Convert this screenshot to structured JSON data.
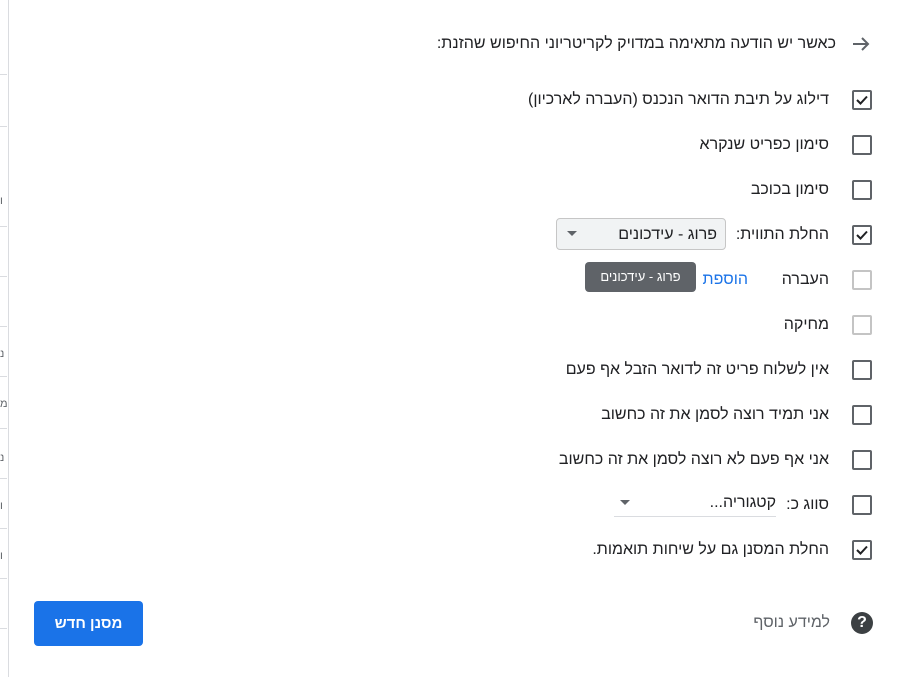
{
  "header": {
    "text": "כאשר יש הודעה מתאימה במדויק לקריטריוני החיפוש שהזנת:",
    "back_icon": "arrow-right-icon"
  },
  "left_edge_glyphs": [
    "ו",
    "נ",
    "מ",
    "נ",
    "ו",
    "ו"
  ],
  "options": [
    {
      "label": "דילוג על תיבת הדואר הנכנס (העברה לארכיון)",
      "checked": true,
      "enabled": true
    },
    {
      "label": "סימון כפריט שנקרא",
      "checked": false,
      "enabled": true
    },
    {
      "label": "סימון בכוכב",
      "checked": false,
      "enabled": true
    },
    {
      "label": "החלת התווית:",
      "checked": true,
      "enabled": true,
      "select_value": "פרוג - עידכונים"
    },
    {
      "label": "העברה",
      "checked": false,
      "enabled": false,
      "link_text": "הוספת"
    },
    {
      "label": "מחיקה",
      "checked": false,
      "enabled": false
    },
    {
      "label": "אין לשלוח פריט זה לדואר הזבל אף פעם",
      "checked": false,
      "enabled": true
    },
    {
      "label": "אני תמיד רוצה לסמן את זה כחשוב",
      "checked": false,
      "enabled": true
    },
    {
      "label": "אני אף פעם לא רוצה לסמן את זה כחשוב",
      "checked": false,
      "enabled": true
    },
    {
      "label": "סווג כ:",
      "checked": false,
      "enabled": true,
      "category_placeholder": "קטגוריה..."
    },
    {
      "label": "החלת המסנן גם על שיחות תואמות.",
      "checked": true,
      "enabled": true
    }
  ],
  "tooltip": {
    "text": "פרוג - עידכונים"
  },
  "footer": {
    "help_text": "למידע נוסף",
    "help_icon": "help-circle-icon",
    "create_button": "מסנן חדש"
  },
  "colors": {
    "accent": "#1a73e8",
    "tooltip_bg": "#5f6368",
    "checkbox_border": "#5f6368"
  }
}
